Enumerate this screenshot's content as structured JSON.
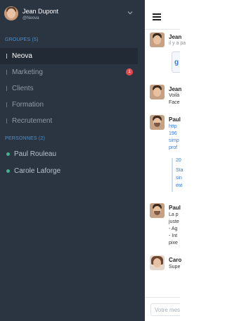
{
  "user": {
    "name": "Jean Dupont",
    "handle": "@Neova"
  },
  "sidebar": {
    "groups_label": "GROUPES (5)",
    "groups": [
      {
        "label": "Neova",
        "active": true
      },
      {
        "label": "Marketing",
        "badge": "1"
      },
      {
        "label": "Clients"
      },
      {
        "label": "Formation"
      },
      {
        "label": "Recrutement"
      }
    ],
    "people_label": "PERSONNES (2)",
    "people": [
      {
        "label": "Paul Rouleau",
        "status_color": "#3fb58c"
      },
      {
        "label": "Carole Laforge",
        "status_color": "#3fb58c"
      }
    ]
  },
  "messages": [
    {
      "author": "Jean",
      "lines": [
        "il y a pa"
      ]
    },
    {
      "author": "Jean",
      "lines": [
        "Voilà",
        "Face"
      ]
    },
    {
      "author": "Paul",
      "lines": [
        "http",
        "196",
        "simp",
        "prof"
      ],
      "preview": [
        "20",
        "Sta",
        "sin",
        "été"
      ]
    },
    {
      "author": "Paul",
      "lines": [
        "La p",
        "juste",
        "- Ag",
        "- Int",
        "pixe"
      ]
    },
    {
      "author": "Caro",
      "lines": [
        "Supe"
      ]
    }
  ],
  "composer": {
    "placeholder": "Votre message"
  },
  "colors": {
    "sidebar_bg": "#2b3542",
    "accent": "#4f8fc6",
    "badge": "#e5484d",
    "online": "#3fb58c"
  }
}
